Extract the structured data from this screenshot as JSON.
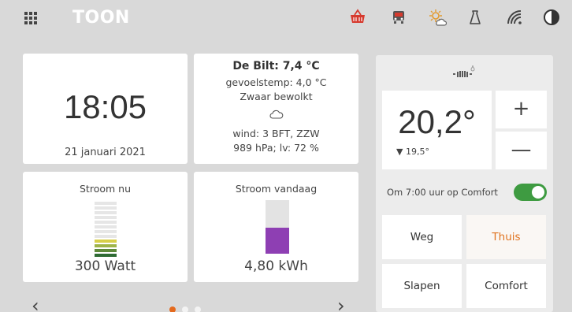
{
  "header": {
    "brand": "TOON",
    "icons": [
      "apps-grid-icon",
      "basket-icon",
      "car-smoke-icon",
      "weather-sun-cloud-icon",
      "bag-icon",
      "wifi-icon",
      "contrast-icon"
    ],
    "alert_color": "#d63a2e"
  },
  "clock": {
    "time": "18:05",
    "date": "21 januari 2021"
  },
  "weather": {
    "title": "De Bilt: 7,4 °C",
    "feels": "gevoelstemp: 4,0 °C",
    "condition": "Zwaar bewolkt",
    "wind": "wind: 3 BFT, ZZW",
    "pressure": "989 hPa; lv: 72 %",
    "icon": "cloud-icon"
  },
  "power_now": {
    "label": "Stroom nu",
    "value": "300 Watt",
    "level_colors": [
      "#e6e6e6",
      "#e6e6e6",
      "#e6e6e6",
      "#e6e6e6",
      "#e6e6e6",
      "#e6e6e6",
      "#e6e6e6",
      "#e6e6e6",
      "#d8cf4a",
      "#9fb448",
      "#5e8a3a",
      "#2f6b34"
    ]
  },
  "power_today": {
    "label": "Stroom vandaag",
    "value": "4,80 kWh",
    "fill_fraction": 0.48,
    "fill_color": "#8e3fb3"
  },
  "thermostat": {
    "current_temp": "20,2°",
    "setpoint": "▼ 19,5°",
    "plus": "+",
    "minus": "—",
    "program_text": "Om 7:00 uur op Comfort",
    "program_enabled": true,
    "modes": [
      {
        "label": "Weg",
        "active": false
      },
      {
        "label": "Thuis",
        "active": true
      },
      {
        "label": "Slapen",
        "active": false
      },
      {
        "label": "Comfort",
        "active": false
      }
    ],
    "accent": "#e0731f",
    "toggle_color": "#3e9b41"
  },
  "nav": {
    "prev": "‹",
    "next": "›",
    "pages": 3,
    "current_page": 1
  }
}
